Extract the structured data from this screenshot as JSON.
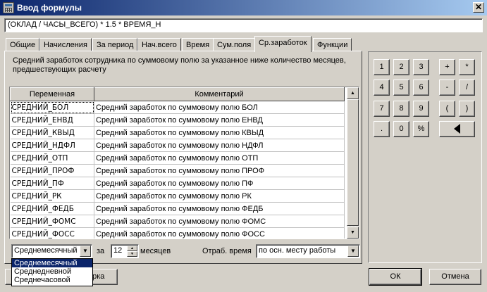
{
  "window": {
    "title": "Ввод формулы",
    "close": "✕"
  },
  "formula": {
    "value": "(ОКЛАД / ЧАСЫ_ВСЕГО) * 1.5 * ВРЕМЯ_Н"
  },
  "tabs": [
    {
      "label": "Общие"
    },
    {
      "label": "Начисления"
    },
    {
      "label": "За период"
    },
    {
      "label": "Нач.всего"
    },
    {
      "label": "Время"
    },
    {
      "label": "Сум.поля"
    },
    {
      "label": "Ср.заработок",
      "active": true
    },
    {
      "label": "Функции"
    }
  ],
  "description": "Средний заработок сотрудника по суммовому полю за указанное ниже количество месяцев, предшествующих расчету",
  "grid": {
    "headers": {
      "variable": "Переменная",
      "comment": "Комментарий"
    },
    "rows": [
      {
        "name": "СРЕДНИЙ_БОЛ",
        "comment": "Средний заработок по суммовому полю БОЛ"
      },
      {
        "name": "СРЕДНИЙ_ЕНВД",
        "comment": "Средний заработок по суммовому полю ЕНВД"
      },
      {
        "name": "СРЕДНИЙ_КВЫД",
        "comment": "Средний заработок по суммовому полю КВЫД"
      },
      {
        "name": "СРЕДНИЙ_НДФЛ",
        "comment": "Средний заработок по суммовому полю НДФЛ"
      },
      {
        "name": "СРЕДНИЙ_ОТП",
        "comment": "Средний заработок по суммовому полю ОТП"
      },
      {
        "name": "СРЕДНИЙ_ПРОФ",
        "comment": "Средний заработок по суммовому полю ПРОФ"
      },
      {
        "name": "СРЕДНИЙ_ПФ",
        "comment": "Средний заработок по суммовому полю ПФ"
      },
      {
        "name": "СРЕДНИЙ_РК",
        "comment": "Средний заработок по суммовому полю РК"
      },
      {
        "name": "СРЕДНИЙ_ФЕДБ",
        "comment": "Средний заработок по суммовому полю ФЕДБ"
      },
      {
        "name": "СРЕДНИЙ_ФОМС",
        "comment": "Средний заработок по суммовому полю ФОМС"
      },
      {
        "name": "СРЕДНИЙ_ФОСС",
        "comment": "Средний заработок по суммовому полю ФОСС"
      }
    ]
  },
  "controls": {
    "avg_type_selected": "Среднемесячный",
    "avg_type_options": [
      "Среднемесячный",
      "Среднедневной",
      "Среднечасовой"
    ],
    "za_label": "за",
    "months_value": "12",
    "months_label": "месяцев",
    "work_time_label": "Отраб. время",
    "work_time_value": "по осн. месту работы",
    "hidden_button_label": "ерка"
  },
  "keypad": {
    "keys": [
      "1",
      "2",
      "3",
      "+",
      "*",
      "4",
      "5",
      "6",
      "-",
      "/",
      "7",
      "8",
      "9",
      "(",
      ")",
      ".",
      "0",
      "%"
    ],
    "backspace": "backspace-left-arrow"
  },
  "buttons": {
    "ok": "ОК",
    "cancel": "Отмена"
  }
}
